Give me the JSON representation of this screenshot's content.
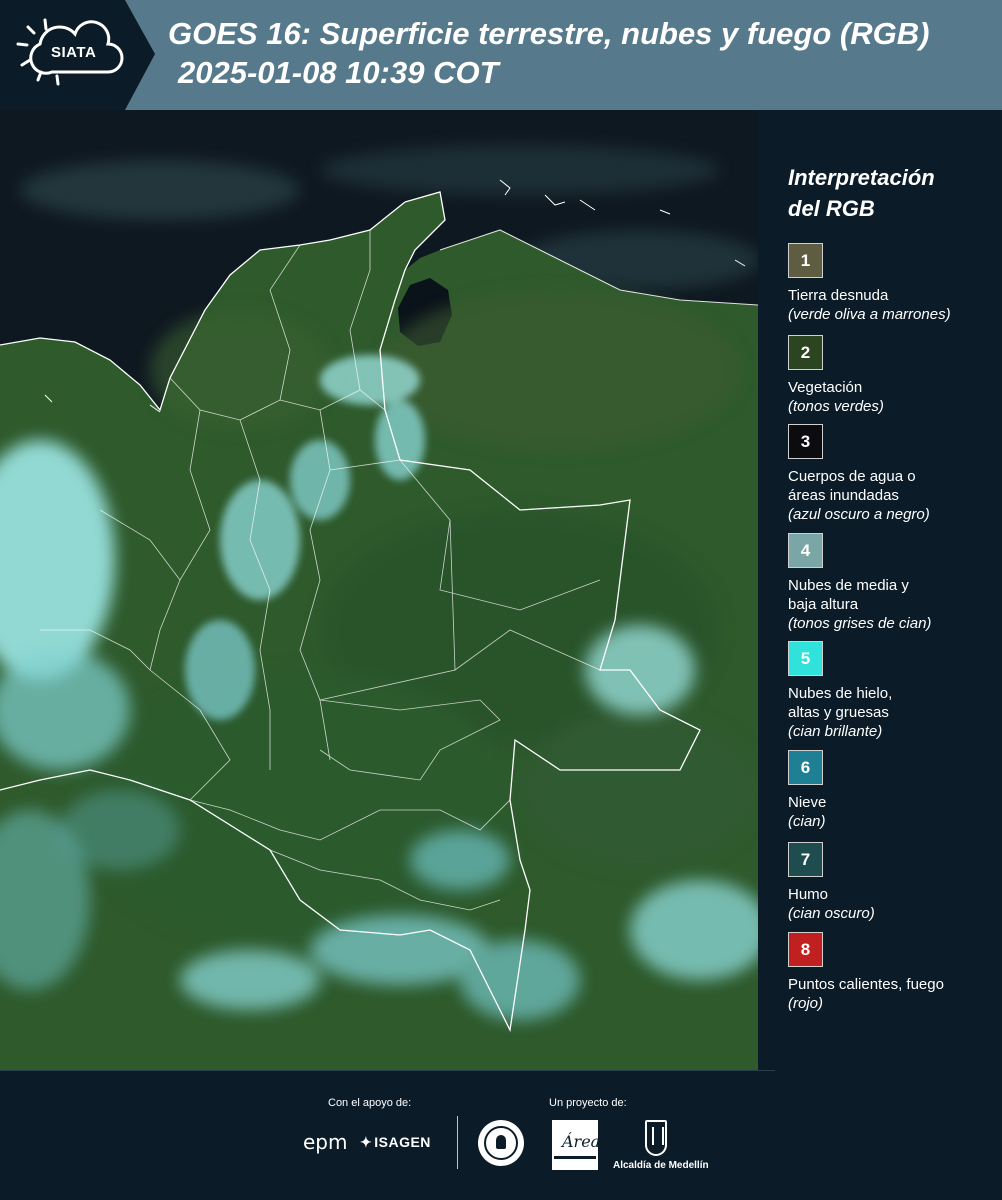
{
  "header": {
    "logo_text": "SIATA",
    "title_line1": "GOES 16: Superficie terrestre, nubes y fuego (RGB)",
    "title_line2": "2025-01-08 10:39 COT"
  },
  "legend": {
    "title_line1": "Interpretación",
    "title_line2": "del RGB",
    "items": [
      {
        "number": "1",
        "color": "#5e5d42",
        "label": "Tierra desnuda",
        "hint": "(verde oliva a marrones)"
      },
      {
        "number": "2",
        "color": "#2b4520",
        "label": "Vegetación",
        "hint": "(tonos verdes)"
      },
      {
        "number": "3",
        "color": "#0b0b10",
        "label": "Cuerpos de agua o áreas inundadas",
        "hint": "(azul oscuro a negro)"
      },
      {
        "number": "4",
        "color": "#7ba6a6",
        "label": "Nubes de media y baja altura",
        "hint": "(tonos grises de cian)"
      },
      {
        "number": "5",
        "color": "#2fe3dc",
        "label": "Nubes de hielo, altas y gruesas",
        "hint": "(cian brillante)"
      },
      {
        "number": "6",
        "color": "#1f7f94",
        "label": "Nieve",
        "hint": "(cian)"
      },
      {
        "number": "7",
        "color": "#1f4c4e",
        "label": "Humo",
        "hint": "(cian oscuro)"
      },
      {
        "number": "8",
        "color": "#c0201f",
        "label": "Puntos calientes, fuego",
        "hint": "(rojo)"
      }
    ]
  },
  "footer": {
    "support_label": "Con el apoyo de:",
    "project_label": "Un proyecto de:",
    "epm": "epm",
    "isagen": "ISAGEN",
    "amva": "Área",
    "medellin": "Alcaldía de Medellín"
  },
  "colors": {
    "header_bg": "#56798b",
    "panel_bg": "#0b1c28",
    "vegetation": "#2f5a2c",
    "ocean": "#0c1218",
    "cloud": "#8fe8e6"
  }
}
